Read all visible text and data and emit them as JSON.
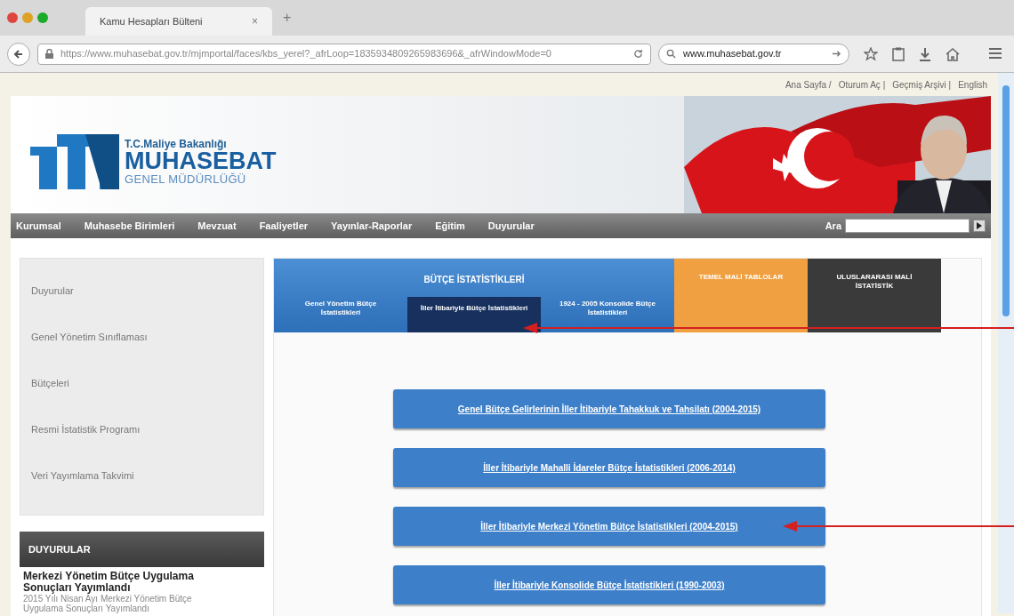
{
  "browser": {
    "tab_title": "Kamu Hesapları Bülteni",
    "tab_close": "×",
    "new_tab": "+",
    "url": "https://www.muhasebat.gov.tr/mjmportal/faces/kbs_yerel?_afrLoop=1835934809265983696&_afrWindowMode=0",
    "search_value": "www.muhasebat.gov.tr"
  },
  "top_links": [
    "Ana Sayfa /",
    "Oturum Aç |",
    "Geçmiş Arşivi |",
    "English"
  ],
  "logo": {
    "ministry": "T.C.Maliye Bakanlığı",
    "name": "MUHASEBAT",
    "subtitle": "GENEL MÜDÜRLÜĞÜ"
  },
  "nav": {
    "items": [
      "Kurumsal",
      "Muhasebe Birimleri",
      "Mevzuat",
      "Faaliyetler",
      "Yayınlar-Raporlar",
      "Eğitim",
      "Duyurular"
    ],
    "search_label": "Ara"
  },
  "sidebar": {
    "items": [
      "Duyurular",
      "Genel Yönetim Sınıflaması",
      "Bütçeleri",
      "Resmi İstatistik Programı",
      "Veri Yayımlama Takvimi"
    ],
    "news_header": "DUYURULAR",
    "news_title": "Merkezi Yönetim Bütçe Uygulama Sonuçları Yayımlandı",
    "news_text": "2015 Yılı Nisan Ayı Merkezi Yönetim Bütçe Uygulama Sonuçları Yayımlandı"
  },
  "tabs": {
    "group_title": "BÜTÇE İSTATİSTİKLERİ",
    "sub_tabs": [
      {
        "label": "Genel Yönetim Bütçe İstatistikleri",
        "selected": false
      },
      {
        "label": "İller İtibariyle Bütçe İstatistikleri",
        "selected": true
      },
      {
        "label": "1924 - 2005 Konsolide Bütçe İstatistikleri",
        "selected": false
      }
    ],
    "other_tabs": [
      {
        "label": "TEMEL MALİ TABLOLAR",
        "color": "#f0a040"
      },
      {
        "label": "ULUSLARARASI MALİ İSTATİSTİK",
        "color": "#3a3a3a"
      }
    ]
  },
  "links": [
    {
      "label": "Genel Bütçe Gelirlerinin İller İtibariyle Tahakkuk ve Tahsilatı (2004-2015)",
      "pointed": false
    },
    {
      "label": "İller İtibariyle Mahalli İdareler Bütçe İstatistikleri (2006-2014)",
      "pointed": false
    },
    {
      "label": "İller İtibariyle Merkezi Yönetim Bütçe İstatistikleri (2004-2015)",
      "pointed": true
    },
    {
      "label": "İller İtibariyle Konsolide Bütçe İstatistikleri (1990-2003)",
      "pointed": false
    }
  ]
}
